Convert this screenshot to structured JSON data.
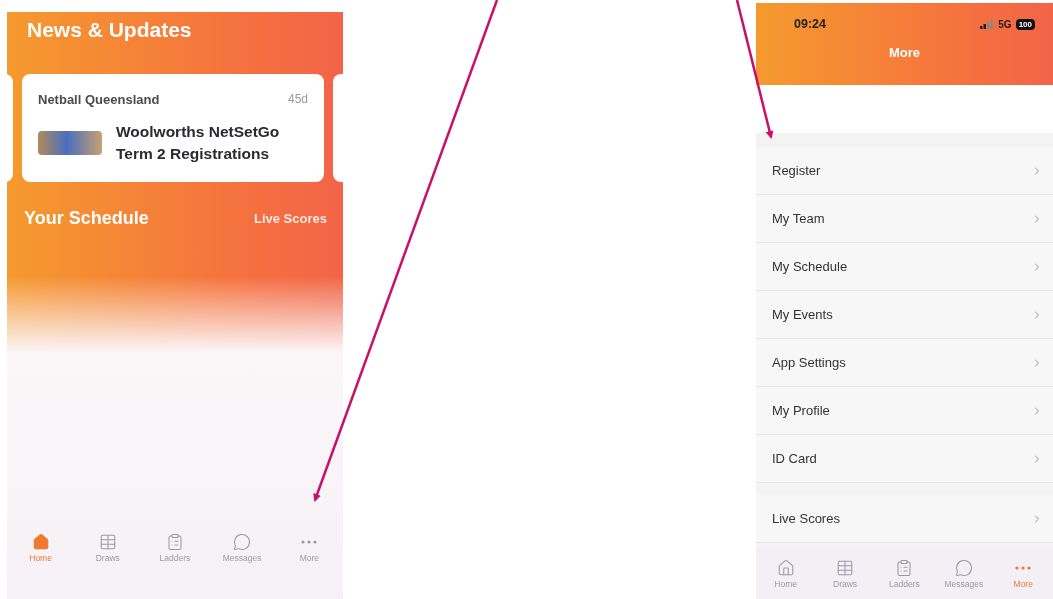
{
  "home_screen": {
    "news_title": "News & Updates",
    "news_card": {
      "source": "Netball Queensland",
      "age": "45d",
      "headline": "Woolworths NetSetGo Term 2 Registrations"
    },
    "schedule_title": "Your Schedule",
    "live_scores_link": "Live Scores",
    "tab_bar": [
      {
        "label": "Home",
        "kind": "home",
        "selected": true
      },
      {
        "label": "Draws",
        "kind": "draws",
        "selected": false
      },
      {
        "label": "Ladders",
        "kind": "ladders",
        "selected": false
      },
      {
        "label": "Messages",
        "kind": "messages",
        "selected": false
      },
      {
        "label": "More",
        "kind": "more",
        "selected": false
      }
    ]
  },
  "more_screen": {
    "status_bar": {
      "time": "09:24",
      "network": "5G",
      "battery": "100"
    },
    "title": "More",
    "menu_groups": [
      [
        "Register",
        "My Team",
        "My Schedule",
        "My Events",
        "App Settings",
        "My Profile",
        "ID Card"
      ],
      [
        "Live Scores"
      ]
    ],
    "tab_bar": [
      {
        "label": "Home",
        "kind": "home",
        "selected": false
      },
      {
        "label": "Draws",
        "kind": "draws",
        "selected": false
      },
      {
        "label": "Ladders",
        "kind": "ladders",
        "selected": false
      },
      {
        "label": "Messages",
        "kind": "messages",
        "selected": false
      },
      {
        "label": "More",
        "kind": "more",
        "selected": true
      }
    ]
  }
}
